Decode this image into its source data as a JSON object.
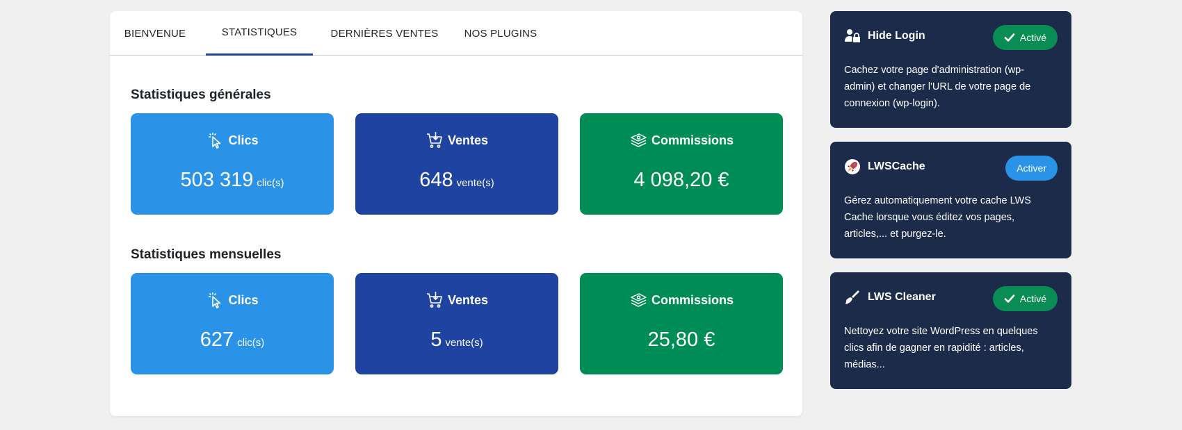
{
  "tabs": [
    {
      "label": "BIENVENUE",
      "active": false
    },
    {
      "label": "STATISTIQUES",
      "active": true
    },
    {
      "label": "DERNIÈRES VENTES",
      "active": false
    },
    {
      "label": "NOS PLUGINS",
      "active": false
    }
  ],
  "general": {
    "title": "Statistiques générales",
    "clics": {
      "label": "Clics",
      "value": "503 319",
      "unit": "clic(s)"
    },
    "ventes": {
      "label": "Ventes",
      "value": "648",
      "unit": "vente(s)"
    },
    "commissions": {
      "label": "Commissions",
      "value": "4 098,20 €"
    }
  },
  "monthly": {
    "title": "Statistiques mensuelles",
    "clics": {
      "label": "Clics",
      "value": "627",
      "unit": "clic(s)"
    },
    "ventes": {
      "label": "Ventes",
      "value": "5",
      "unit": "vente(s)"
    },
    "commissions": {
      "label": "Commissions",
      "value": "25,80 €"
    }
  },
  "plugins": [
    {
      "name": "Hide Login",
      "status": "Activé",
      "icon": "user-lock-icon",
      "description": "Cachez votre page d'administration (wp-admin) et changer l'URL de votre page de connexion (wp-login)."
    },
    {
      "name": "LWSCache",
      "status": "Activer",
      "icon": "rocket-icon",
      "description": "Gérez automatiquement votre cache LWS Cache lorsque vous éditez vos pages, articles,... et purgez-le."
    },
    {
      "name": "LWS Cleaner",
      "status": "Activé",
      "icon": "broom-icon",
      "description": "Nettoyez votre site WordPress en quelques clics afin de gagner en rapidité : articles, médias..."
    }
  ],
  "colors": {
    "clics": "#2a93e8",
    "ventes": "#1f43a0",
    "commissions": "#008c55",
    "plugin_bg": "#1c2b4a",
    "active_tab": "#1e40a0"
  }
}
